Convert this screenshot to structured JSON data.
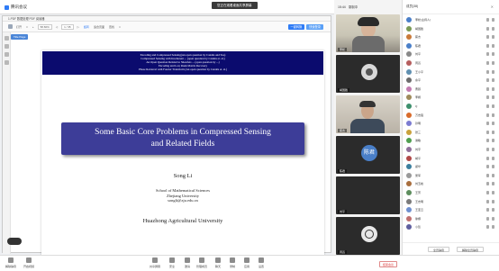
{
  "app": {
    "brand": "腾讯会议",
    "sharing_notice": "您正在观看桌面共享屏幕"
  },
  "pdf": {
    "window_title": "1.PDF 数据处理 PDF 阅读器",
    "toolbar": [
      "打开",
      "□",
      "+",
      "58.66%",
      "◁",
      "1 / 35",
      "▷",
      "旋转",
      "适合页面",
      "查找",
      "□"
    ],
    "toolbar_right": [
      {
        "label": "一键转换",
        "color": "#2f7cf6"
      },
      {
        "label": "快速登录",
        "color": "#5aa0f7"
      }
    ],
    "tab_label": "Title Page",
    "nav_header_lines": [
      "Encoding and Compressed Sensing(An open question by Candès and Tao)",
      "Compressed Sensing with Incoherent ... (open question by Candès et. al.)",
      "An Open Question Related to Shearlets ... (open question by ...)",
      "Encoding and Low Rank Matrix Recovery",
      "Phase Retrieval with Fourier Transform (An open question by Candès et. al.)"
    ],
    "slide_title_line1": "Some Basic Core Problems in Compressed Sensing",
    "slide_title_line2": "and Related Fields",
    "author": "Song Li",
    "institution_line1": "School of Mathematical Sciences",
    "institution_line2": "Zhejiang University",
    "institution_email": "songli@zju.edu.cn",
    "university": "Huazhong Agricultural University"
  },
  "video": {
    "header": [
      "15:44",
      "录制中"
    ],
    "tiles": [
      {
        "name": "李松"
      },
      {
        "name": "胡国胜"
      },
      {
        "name": "蔡杰"
      },
      {
        "name": "陈君",
        "avatar_text": "陈君"
      },
      {
        "name": "刘平"
      },
      {
        "name": "周嵩"
      }
    ]
  },
  "participants": {
    "title": "成员(38)",
    "close": "✕",
    "list": [
      {
        "name": "李松(主持人)",
        "color": "#4a7fc8"
      },
      {
        "name": "胡国胜",
        "color": "#7a9a55"
      },
      {
        "name": "蔡杰",
        "color": "#c97a3a"
      },
      {
        "name": "陈君",
        "color": "#4a7fc8"
      },
      {
        "name": "刘平",
        "color": "#888888"
      },
      {
        "name": "周嵩",
        "color": "#b55d5d"
      },
      {
        "name": "王小平",
        "color": "#5f8fb0"
      },
      {
        "name": "余平",
        "color": "#6b6b6b"
      },
      {
        "name": "曹颖",
        "color": "#c27bb0"
      },
      {
        "name": "李娟",
        "color": "#9e8a5a"
      },
      {
        "name": "Q",
        "color": "#3d8f6c"
      },
      {
        "name": "万志强",
        "color": "#d86b2b"
      },
      {
        "name": "孙明",
        "color": "#7b7bd1"
      },
      {
        "name": "张三",
        "color": "#c9a13b"
      },
      {
        "name": "谢敏",
        "color": "#4f9e4f"
      },
      {
        "name": "刘宇",
        "color": "#8f6f9a"
      },
      {
        "name": "胡平",
        "color": "#b04848"
      },
      {
        "name": "郑华",
        "color": "#3b7f9e"
      },
      {
        "name": "吴军",
        "color": "#999999"
      },
      {
        "name": "刘玉峰",
        "color": "#a86e3d"
      },
      {
        "name": "王芳",
        "color": "#5d8d5d"
      },
      {
        "name": "王志明",
        "color": "#7a7a7a"
      },
      {
        "name": "王亚云",
        "color": "#6e8fcf"
      },
      {
        "name": "徐娜",
        "color": "#bf6f6f"
      },
      {
        "name": "小哲",
        "color": "#5f5f9f"
      }
    ],
    "footer_buttons": [
      "全员静音",
      "解除全员静音"
    ]
  },
  "bottombar": {
    "left": [
      {
        "label": "解除静音"
      },
      {
        "label": "开启视频"
      }
    ],
    "center": [
      {
        "label": "共享屏幕"
      },
      {
        "label": "安全"
      },
      {
        "label": "邀请"
      },
      {
        "label": "管理成员"
      },
      {
        "label": "聊天"
      },
      {
        "label": "录制"
      },
      {
        "label": "应用"
      },
      {
        "label": "设置"
      }
    ],
    "end_button": "结束会议"
  }
}
